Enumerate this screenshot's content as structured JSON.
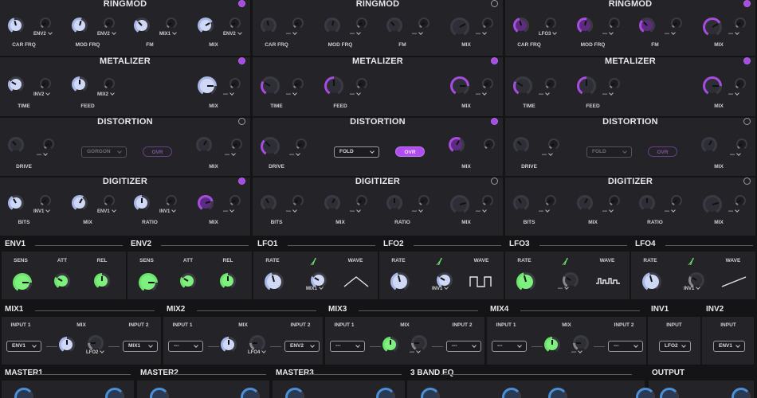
{
  "colors": {
    "accent": "#a64ce0",
    "knob_blue": "#a9b7e6",
    "knob_green": "#6ee26e",
    "knob_purple": "#a64ce0",
    "bg": "#141416",
    "panel": "#242428"
  },
  "fx_columns": [
    {
      "ringmod": {
        "title": "RINGMOD",
        "power": true,
        "labels": [
          "CAR FRQ",
          "MOD FRQ",
          "FM",
          "MIX"
        ],
        "mods": [
          "ENV2",
          "ENV2",
          "MIX1",
          "ENV2"
        ]
      },
      "metalizer": {
        "title": "METALIZER",
        "power": true,
        "labels": [
          "TIME",
          "FEED",
          "MIX"
        ],
        "mods": [
          "INV2",
          "MIX2",
          "---"
        ]
      },
      "distortion": {
        "title": "DISTORTION",
        "power": false,
        "labels": [
          "DRIVE",
          "MIX"
        ],
        "mods": [
          "---",
          "---"
        ],
        "type": "GORGON",
        "ovr": "OVR",
        "ovr_on": false
      },
      "digitizer": {
        "title": "DIGITIZER",
        "power": true,
        "labels": [
          "BITS",
          "MIX",
          "RATIO",
          "MIX"
        ],
        "mods": [
          "INV1",
          "ENV1",
          "INV1",
          "---"
        ]
      }
    },
    {
      "ringmod": {
        "title": "RINGMOD",
        "power": false,
        "labels": [
          "CAR FRQ",
          "MOD FRQ",
          "FM",
          "MIX"
        ],
        "mods": [
          "---",
          "---",
          "---",
          "---"
        ]
      },
      "metalizer": {
        "title": "METALIZER",
        "power": true,
        "labels": [
          "TIME",
          "FEED",
          "MIX"
        ],
        "mods": [
          "---",
          "---",
          "---"
        ]
      },
      "distortion": {
        "title": "DISTORTION",
        "power": true,
        "labels": [
          "DRIVE",
          "MIX"
        ],
        "mods": [
          "---"
        ],
        "type": "FOLD",
        "ovr": "OVR",
        "ovr_on": true
      },
      "digitizer": {
        "title": "DIGITIZER",
        "power": false,
        "labels": [
          "BITS",
          "MIX",
          "RATIO",
          "MIX"
        ],
        "mods": [
          "---",
          "---",
          "---",
          "---"
        ]
      }
    },
    {
      "ringmod": {
        "title": "RINGMOD",
        "power": true,
        "labels": [
          "CAR FRQ",
          "MOD FRQ",
          "FM",
          "MIX"
        ],
        "mods": [
          "LFO3",
          "---",
          "---",
          "---"
        ]
      },
      "metalizer": {
        "title": "METALIZER",
        "power": true,
        "labels": [
          "TIME",
          "FEED",
          "MIX"
        ],
        "mods": [
          "---",
          "---",
          "---"
        ]
      },
      "distortion": {
        "title": "DISTORTION",
        "power": false,
        "labels": [
          "DRIVE",
          "MIX"
        ],
        "mods": [
          "---",
          "---"
        ],
        "type": "FOLD",
        "ovr": "OVR",
        "ovr_on": false
      },
      "digitizer": {
        "title": "DIGITIZER",
        "power": false,
        "labels": [
          "BITS",
          "MIX",
          "RATIO",
          "MIX"
        ],
        "mods": [
          "---",
          "---",
          "---",
          "---"
        ]
      }
    }
  ],
  "envs": [
    {
      "title": "ENV1",
      "labels": [
        "SENS",
        "ATT",
        "REL"
      ]
    },
    {
      "title": "ENV2",
      "labels": [
        "SENS",
        "ATT",
        "REL"
      ]
    }
  ],
  "lfos": [
    {
      "title": "LFO1",
      "rate": "RATE",
      "wave_label": "WAVE",
      "mod": "MIX1",
      "wave": "triangle"
    },
    {
      "title": "LFO2",
      "rate": "RATE",
      "wave_label": "WAVE",
      "mod": "INV1",
      "wave": "square"
    },
    {
      "title": "LFO3",
      "rate": "RATE",
      "wave_label": "WAVE",
      "mod": "---",
      "wave": "random"
    },
    {
      "title": "LFO4",
      "rate": "RATE",
      "wave_label": "WAVE",
      "mod": "INV1",
      "wave": "ramp"
    }
  ],
  "mixes": [
    {
      "title": "MIX1",
      "input1": "INPUT 1",
      "mix": "MIX",
      "input2": "INPUT 2",
      "in1": "ENV1",
      "in2": "MIX1",
      "mod": "LFO2"
    },
    {
      "title": "MIX2",
      "input1": "INPUT 1",
      "mix": "MIX",
      "input2": "INPUT 2",
      "in1": "---",
      "in2": "ENV2",
      "mod": "LFO4"
    },
    {
      "title": "MIX3",
      "input1": "INPUT 1",
      "mix": "MIX",
      "input2": "INPUT 2",
      "in1": "---",
      "in2": "---",
      "mod": "---"
    },
    {
      "title": "MIX4",
      "input1": "INPUT 1",
      "mix": "MIX",
      "input2": "INPUT 2",
      "in1": "---",
      "in2": "---",
      "mod": "---"
    }
  ],
  "invs": [
    {
      "title": "INV1",
      "input": "INPUT",
      "value": "LFO2"
    },
    {
      "title": "INV2",
      "input": "INPUT",
      "value": "ENV1"
    }
  ],
  "bottom": {
    "master1": "MASTER1",
    "master2": "MASTER2",
    "master3": "MASTER3",
    "eq": "3 BAND EQ",
    "output": "OUTPUT"
  }
}
